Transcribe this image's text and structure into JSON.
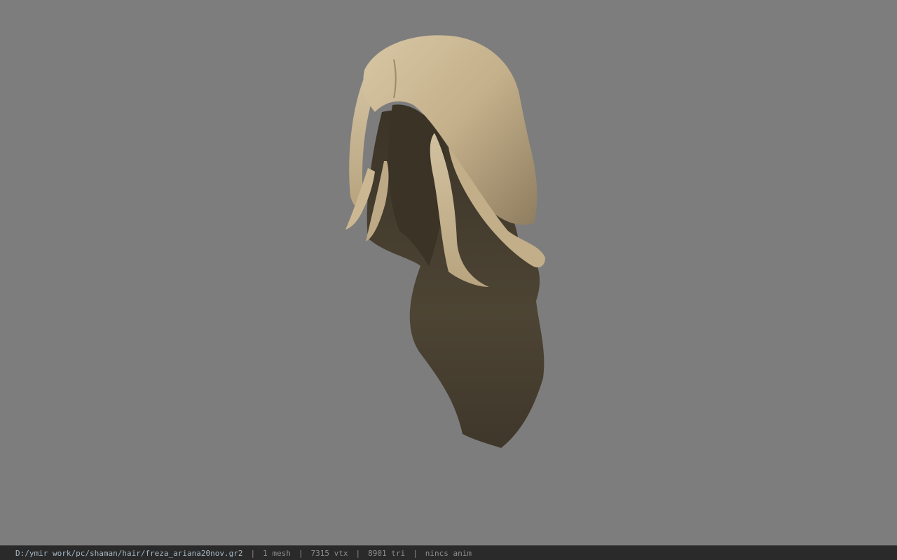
{
  "viewer": {
    "background_color": "#7d7d7d",
    "model_icon": "hair-mesh-model"
  },
  "statusbar": {
    "file_path": "D:/ymir work/pc/shaman/hair/freza_ariana20nov.gr2",
    "separator": "|",
    "mesh_count": "1 mesh",
    "vertex_count": "7315 vtx",
    "triangle_count": "8901 tri",
    "anim_status": "nincs anim"
  }
}
